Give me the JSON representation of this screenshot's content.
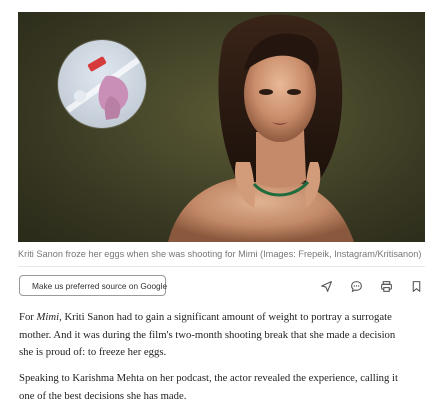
{
  "article": {
    "image_caption": "Kriti Sanon froze her eggs when she was shooting for Mimi (Images: Frepeik, Instagram/Kritisanon)",
    "preferred_source_button": "Make us preferred source on Google",
    "paragraph1": {
      "lead": "For ",
      "italic": "Mimi",
      "rest_line1": ", Kriti Sanon had to gain a significant amount of weight to portray a surrogate",
      "line2": "mother. And it was during the film's two-month shooting break that she made a decision",
      "line3": "she is proud of: to freeze her eggs."
    },
    "paragraph2": {
      "line1": "Speaking to Karishma Mehta on her podcast, the actor revealed the experience, calling it",
      "line2": "one of the best decisions she has made."
    }
  },
  "actions": {
    "icons": [
      "share-icon",
      "comment-icon",
      "print-icon",
      "bookmark-icon"
    ]
  },
  "colors": {
    "hero_background": "#45452a",
    "caption_text": "#777777",
    "body_text": "#1f1f1f",
    "google_blue": "#4285F4",
    "google_red": "#EA4335",
    "google_yellow": "#FBBC05",
    "google_green": "#34A853"
  }
}
